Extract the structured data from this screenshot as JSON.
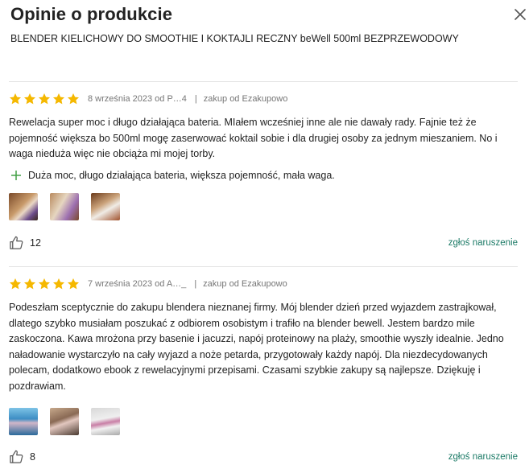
{
  "modal": {
    "title": "Opinie o produkcie",
    "product_name": "BLENDER KIELICHOWY DO SMOOTHIE I KOKTAJLI RECZNY beWell 500ml BEZPRZEWODOWY",
    "close_icon": "close-icon"
  },
  "colors": {
    "star": "#f5b800",
    "accent": "#1b7a66",
    "plus": "#43a047",
    "divider": "#e3e3e3"
  },
  "reviews": [
    {
      "rating": 5,
      "date_author": "8 września 2023 od P…4",
      "source": "zakup od Ezakupowo",
      "text": "Rewelacja super moc i długo działająca bateria. MIałem wcześniej inne ale nie dawały rady. Fajnie też że pojemność większa bo 500ml mogę zaserwować koktail sobie i dla drugiej osoby za jednym mieszaniem. No i waga nieduża więc nie obciąża mi mojej torby.",
      "pros": "Duża moc, długo działająca bateria, większa pojemność, mała waga.",
      "photos": 3,
      "likes": "12",
      "report": "zgłoś naruszenie"
    },
    {
      "rating": 5,
      "date_author": "7 września 2023 od A…_",
      "source": "zakup od Ezakupowo",
      "text": "Podeszłam sceptycznie do zakupu blendera nieznanej firmy. Mój blender dzień przed wyjazdem zastrajkował, dlatego szybko musiałam poszukać z odbiorem osobistym i trafiło na blender bewell. Jestem bardzo mile zaskoczona. Kawa mrożona przy basenie i jacuzzi, napój proteinowy na plaży, smoothie wyszły idealnie. Jedno naładowanie wystarczyło na cały wyjazd a noże petarda, przygotowały każdy napój. Dla niezdecydowanych polecam, dodatkowo ebook z rewelacyjnymi przepisami. Czasami szybkie zakupy są najlepsze. Dziękuję i pozdrawiam.",
      "photos": 3,
      "likes": "8",
      "report": "zgłoś naruszenie"
    }
  ]
}
